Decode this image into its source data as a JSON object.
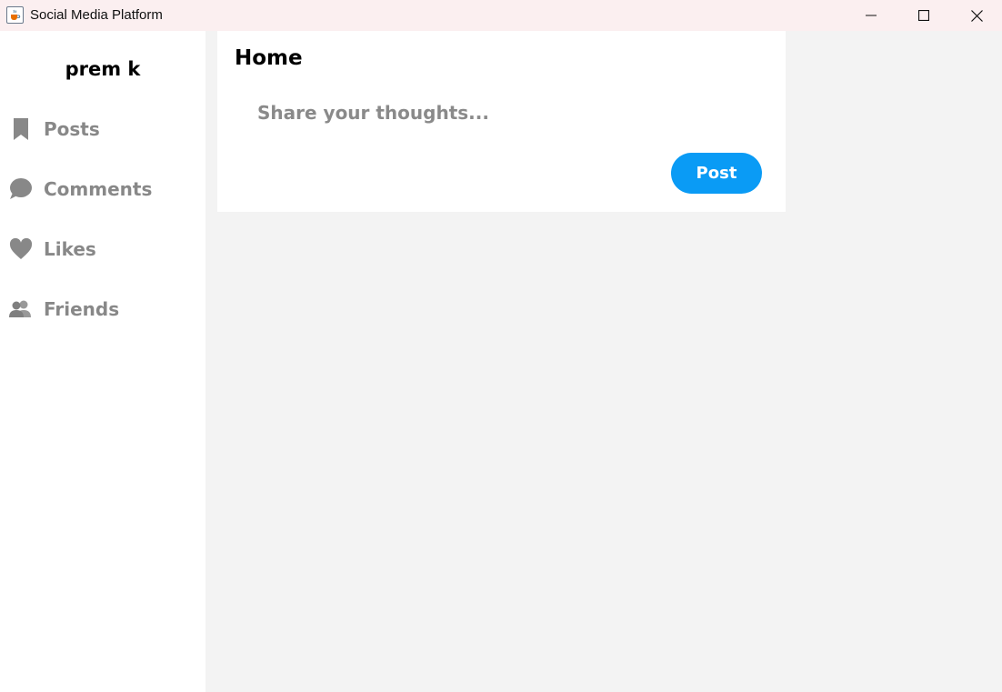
{
  "window": {
    "title": "Social Media Platform",
    "app_icon": "java-cup-icon",
    "controls": [
      "minimize-icon",
      "maximize-icon",
      "close-icon"
    ]
  },
  "sidebar": {
    "username": "prem k",
    "items": [
      {
        "label": "Posts",
        "icon": "bookmark-icon"
      },
      {
        "label": "Comments",
        "icon": "speech-bubble-icon"
      },
      {
        "label": "Likes",
        "icon": "heart-icon"
      },
      {
        "label": "Friends",
        "icon": "users-icon"
      }
    ]
  },
  "main": {
    "title": "Home",
    "composer": {
      "placeholder": "Share your thoughts...",
      "value": "",
      "post_label": "Post"
    }
  },
  "colors": {
    "accent": "#0a9bf5",
    "nav_text": "#888888",
    "background": "#f3f3f3",
    "panel": "#ffffff",
    "titlebar": "#fbeff0"
  }
}
